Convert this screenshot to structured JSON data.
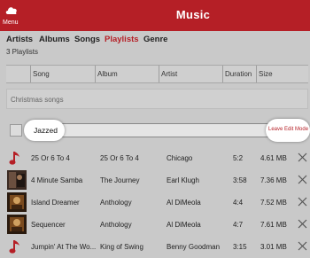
{
  "app": {
    "title": "Music",
    "menu_label": "Menu"
  },
  "tabs": [
    {
      "label": "Artists",
      "active": false
    },
    {
      "label": "Albums",
      "active": false
    },
    {
      "label": "Songs",
      "active": false
    },
    {
      "label": "Playlists",
      "active": true
    },
    {
      "label": "Genre",
      "active": false
    }
  ],
  "playlist_count": "3 Playlists",
  "columns": {
    "song": "Song",
    "album": "Album",
    "artist": "Artist",
    "duration": "Duration",
    "size": "Size"
  },
  "playlists": [
    {
      "name": "Christmas songs"
    }
  ],
  "edit": {
    "name": "Jazzed",
    "leave_label": "Leave Edit Mode"
  },
  "songs": [
    {
      "title": "25 Or 6 To 4",
      "album": "25 Or 6 To 4",
      "artist": "Chicago",
      "duration": "5:2",
      "size": "4.61 MB",
      "thumb": "music-note-icon"
    },
    {
      "title": "4 Minute Samba",
      "album": "The Journey",
      "artist": "Earl Klugh",
      "duration": "3:58",
      "size": "7.36 MB",
      "thumb": "album-art"
    },
    {
      "title": "Island Dreamer",
      "album": "Anthology",
      "artist": "Al DiMeola",
      "duration": "4:4",
      "size": "7.52 MB",
      "thumb": "album-art"
    },
    {
      "title": "Sequencer",
      "album": "Anthology",
      "artist": "Al DiMeola",
      "duration": "4:7",
      "size": "7.61 MB",
      "thumb": "album-art"
    },
    {
      "title": "Jumpin' At The Wo...",
      "album": "King of Swing",
      "artist": "Benny Goodman",
      "duration": "3:15",
      "size": "3.01 MB",
      "thumb": "music-note-icon"
    }
  ],
  "colors": {
    "accent": "#b51f26",
    "background": "#c9c9c9"
  }
}
